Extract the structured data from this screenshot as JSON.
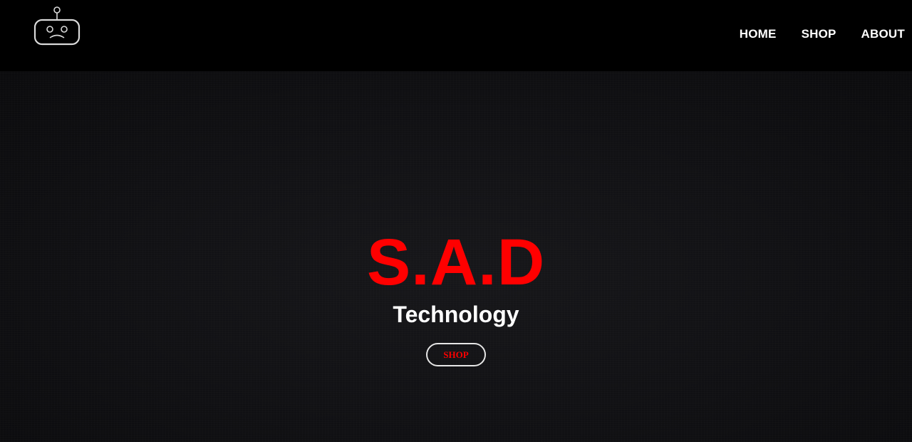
{
  "header": {
    "logo_icon": "sad-robot-icon",
    "nav": [
      {
        "label": "HOME"
      },
      {
        "label": "SHOP"
      },
      {
        "label": "ABOUT"
      }
    ]
  },
  "hero": {
    "title": "S.A.D",
    "subtitle": "Technology",
    "button_label": "SHOP"
  },
  "colors": {
    "accent": "#ff0000",
    "background": "#000000",
    "hero_background": "#111114",
    "text": "#ffffff"
  }
}
